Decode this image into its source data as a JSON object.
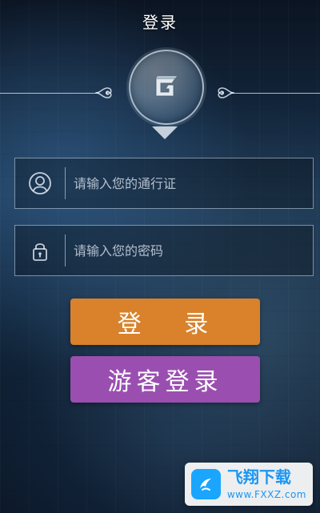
{
  "header": {
    "title": "登录"
  },
  "form": {
    "username_placeholder": "请输入您的通行证",
    "password_placeholder": "请输入您的密码"
  },
  "buttons": {
    "login_label": "登 录",
    "guest_label": "游客登录"
  },
  "watermark": {
    "title": "飞翔下载",
    "url": "www.FXXZ.com"
  },
  "icons": {
    "logo": "g-logo-icon",
    "user": "user-icon",
    "lock": "lock-icon",
    "ornament_left": "ornament-left-icon",
    "ornament_right": "ornament-right-icon",
    "arrow_down": "chevron-down-icon",
    "watermark_logo": "fxxz-logo-icon"
  },
  "colors": {
    "login_button": "#d9822b",
    "guest_button": "#9a4fb0",
    "watermark_accent": "#1a96f2"
  }
}
